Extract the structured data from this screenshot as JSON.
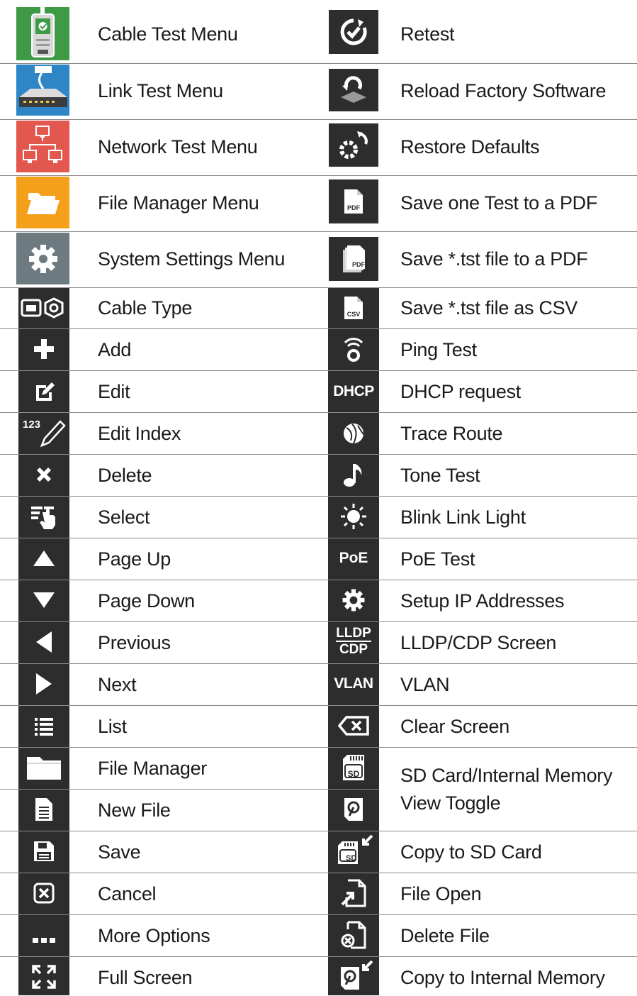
{
  "left": [
    {
      "label": "Cable Test Menu",
      "icon": "cable-tester-icon",
      "bg": "#3e9a45"
    },
    {
      "label": "Link Test Menu",
      "icon": "network-switch-icon",
      "bg": "#2f86c7"
    },
    {
      "label": "Network Test Menu",
      "icon": "network-computers-icon",
      "bg": "#e3584e"
    },
    {
      "label": "File Manager Menu",
      "icon": "folder-open-icon",
      "bg": "#f5a01b"
    },
    {
      "label": "System Settings Menu",
      "icon": "gear-icon",
      "bg": "#6d7a80"
    },
    {
      "label": "Cable Type",
      "icon": "cable-type-icon"
    },
    {
      "label": "Add",
      "icon": "plus-icon"
    },
    {
      "label": "Edit",
      "icon": "edit-icon"
    },
    {
      "label": "Edit Index",
      "icon": "edit-index-icon"
    },
    {
      "label": "Delete",
      "icon": "x-icon"
    },
    {
      "label": "Select",
      "icon": "select-hand-icon"
    },
    {
      "label": "Page Up",
      "icon": "triangle-up-icon"
    },
    {
      "label": "Page Down",
      "icon": "triangle-down-icon"
    },
    {
      "label": "Previous",
      "icon": "triangle-left-icon"
    },
    {
      "label": "Next",
      "icon": "triangle-right-icon"
    },
    {
      "label": "List",
      "icon": "list-icon"
    },
    {
      "label": "File Manager",
      "icon": "folder-icon"
    },
    {
      "label": "New File",
      "icon": "new-file-icon"
    },
    {
      "label": "Save",
      "icon": "floppy-disk-icon"
    },
    {
      "label": "Cancel",
      "icon": "cancel-box-icon"
    },
    {
      "label": "More Options",
      "icon": "more-dots-icon"
    },
    {
      "label": "Full Screen",
      "icon": "full-screen-icon"
    }
  ],
  "right": [
    {
      "label": "Retest",
      "icon": "retest-icon"
    },
    {
      "label": "Reload Factory Software",
      "icon": "reload-software-icon"
    },
    {
      "label": "Restore Defaults",
      "icon": "restore-defaults-icon"
    },
    {
      "label": "Save one Test to a PDF",
      "icon": "pdf-icon",
      "icon_text": "PDF"
    },
    {
      "label": "Save *.tst file to a PDF",
      "icon": "pdf-stack-icon",
      "icon_text": "PDF"
    },
    {
      "label": "Save *.tst file as CSV",
      "icon": "csv-icon",
      "icon_text": "CSV"
    },
    {
      "label": "Ping Test",
      "icon": "ping-icon"
    },
    {
      "label": "DHCP request",
      "icon": "dhcp-icon",
      "icon_text": "DHCP"
    },
    {
      "label": "Trace Route",
      "icon": "globe-icon"
    },
    {
      "label": "Tone Test",
      "icon": "music-note-icon"
    },
    {
      "label": "Blink Link Light",
      "icon": "blink-light-icon"
    },
    {
      "label": "PoE Test",
      "icon": "poe-icon",
      "icon_text": "PoE"
    },
    {
      "label": "Setup IP Addresses",
      "icon": "gear-icon"
    },
    {
      "label": "LLDP/CDP Screen",
      "icon": "lldp-cdp-icon",
      "icon_text": "LLDP",
      "icon_text2": "CDP"
    },
    {
      "label": "VLAN",
      "icon": "vlan-icon",
      "icon_text": "VLAN"
    },
    {
      "label": "Clear Screen",
      "icon": "clear-screen-icon"
    },
    {
      "label": "SD Card/Internal Memory",
      "label2": "View Toggle",
      "icon": "sd-card-icon",
      "icon_text": "SD",
      "icon2": "internal-memory-icon"
    },
    {
      "label": "Copy to SD Card",
      "icon": "copy-to-sd-icon",
      "icon_text": "SD"
    },
    {
      "label": "File Open",
      "icon": "file-open-icon"
    },
    {
      "label": "Delete File",
      "icon": "delete-file-icon"
    },
    {
      "label": "Copy to Internal Memory",
      "icon": "copy-to-internal-memory-icon"
    }
  ]
}
